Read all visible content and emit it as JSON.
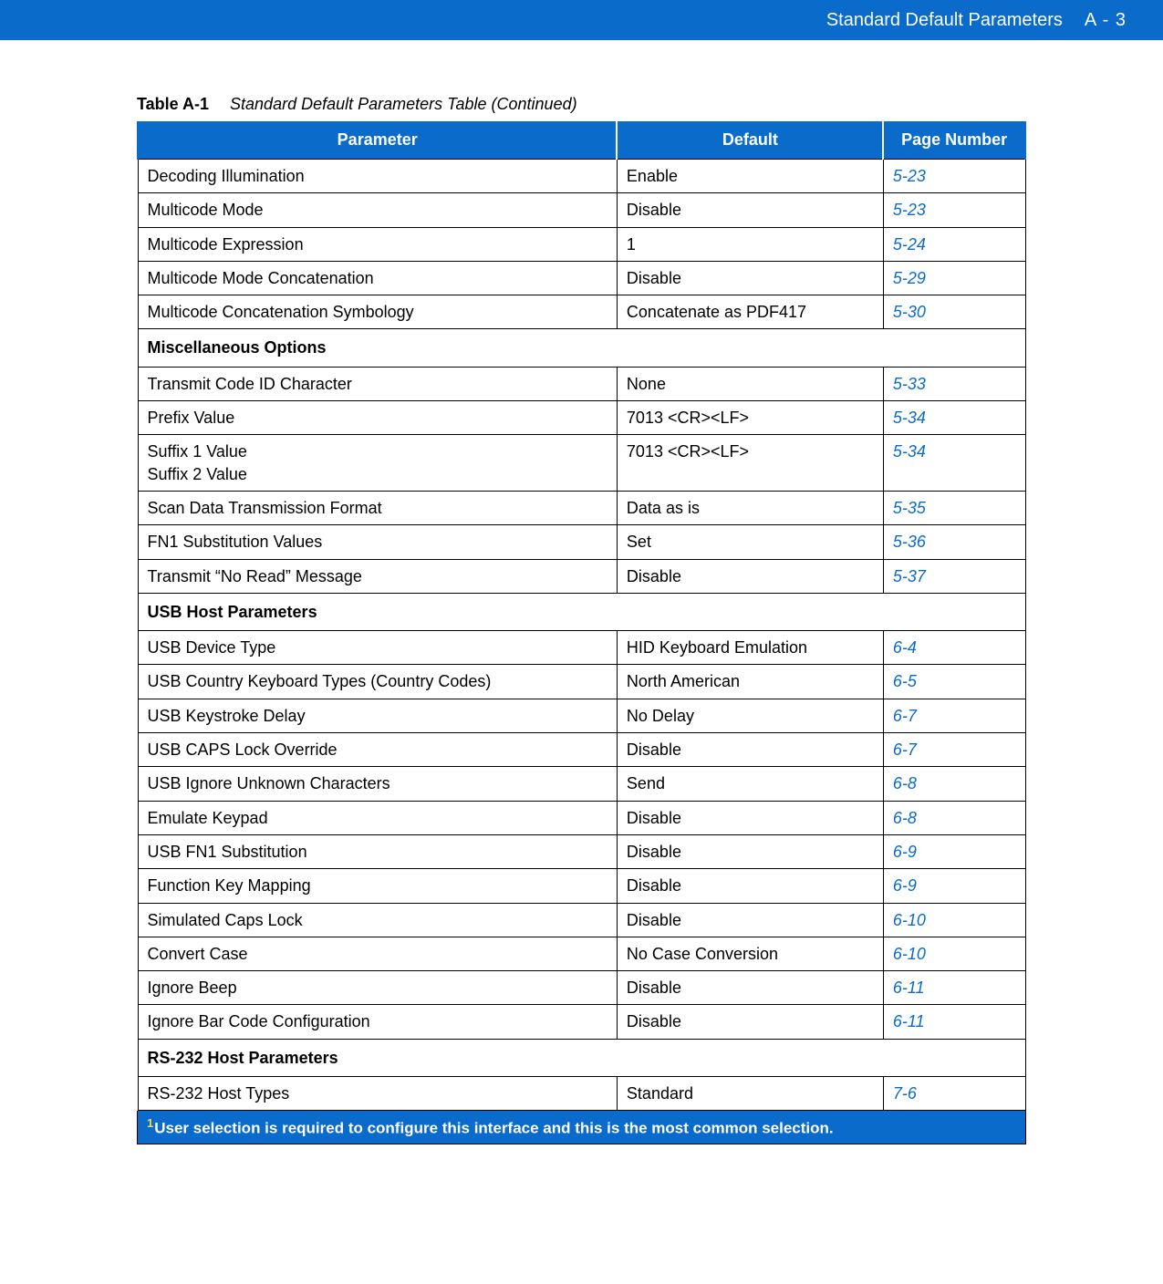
{
  "header": {
    "section": "Standard Default Parameters",
    "page": "A - 3"
  },
  "caption": {
    "label": "Table A-1",
    "text": "Standard Default Parameters Table (Continued)"
  },
  "columns": {
    "parameter": "Parameter",
    "default": "Default",
    "page": "Page Number"
  },
  "rows": [
    {
      "type": "data",
      "param": "Decoding Illumination",
      "default": "Enable",
      "page": "5-23"
    },
    {
      "type": "data",
      "param": "Multicode Mode",
      "default": "Disable",
      "page": "5-23"
    },
    {
      "type": "data",
      "param": "Multicode Expression",
      "default": "1",
      "page": "5-24"
    },
    {
      "type": "data",
      "param": "Multicode Mode Concatenation",
      "default": "Disable",
      "page": "5-29"
    },
    {
      "type": "data",
      "param": "Multicode Concatenation Symbology",
      "default": "Concatenate as PDF417",
      "page": "5-30"
    },
    {
      "type": "section",
      "title": "Miscellaneous Options"
    },
    {
      "type": "data",
      "param": "Transmit Code ID Character",
      "default": "None",
      "page": "5-33"
    },
    {
      "type": "data",
      "param": "Prefix Value",
      "default": "7013 <CR><LF>",
      "page": "5-34"
    },
    {
      "type": "data",
      "param": "Suffix 1 Value\nSuffix 2 Value",
      "default": "7013 <CR><LF>",
      "page": "5-34"
    },
    {
      "type": "data",
      "param": "Scan Data Transmission Format",
      "default": "Data as is",
      "page": "5-35"
    },
    {
      "type": "data",
      "param": "FN1 Substitution Values",
      "default": "Set",
      "page": "5-36"
    },
    {
      "type": "data",
      "param": "Transmit “No Read” Message",
      "default": "Disable",
      "page": "5-37"
    },
    {
      "type": "section",
      "title": "USB Host Parameters"
    },
    {
      "type": "data",
      "param": "USB Device Type",
      "default": "HID Keyboard Emulation",
      "page": "6-4"
    },
    {
      "type": "data",
      "param": "USB Country Keyboard Types (Country Codes)",
      "default": "North American",
      "page": "6-5"
    },
    {
      "type": "data",
      "param": "USB Keystroke Delay",
      "default": "No Delay",
      "page": "6-7"
    },
    {
      "type": "data",
      "param": "USB CAPS Lock Override",
      "default": "Disable",
      "page": "6-7"
    },
    {
      "type": "data",
      "param": "USB Ignore Unknown Characters",
      "default": "Send",
      "page": "6-8"
    },
    {
      "type": "data",
      "param": "Emulate Keypad",
      "default": "Disable",
      "page": "6-8"
    },
    {
      "type": "data",
      "param": "USB FN1 Substitution",
      "default": "Disable",
      "page": "6-9"
    },
    {
      "type": "data",
      "param": "Function Key Mapping",
      "default": "Disable",
      "page": "6-9"
    },
    {
      "type": "data",
      "param": "Simulated Caps Lock",
      "default": "Disable",
      "page": "6-10"
    },
    {
      "type": "data",
      "param": "Convert Case",
      "default": "No Case Conversion",
      "page": "6-10"
    },
    {
      "type": "data",
      "param": "Ignore Beep",
      "default": "Disable",
      "page": "6-11"
    },
    {
      "type": "data",
      "param": "Ignore Bar Code Configuration",
      "default": "Disable",
      "page": "6-11"
    },
    {
      "type": "section",
      "title": "RS-232 Host Parameters"
    },
    {
      "type": "data",
      "param": "RS-232 Host Types",
      "default": "Standard",
      "page": "7-6"
    }
  ],
  "footnote": {
    "marker": "1",
    "text": "User selection is required to configure this interface and this is the most common selection."
  }
}
